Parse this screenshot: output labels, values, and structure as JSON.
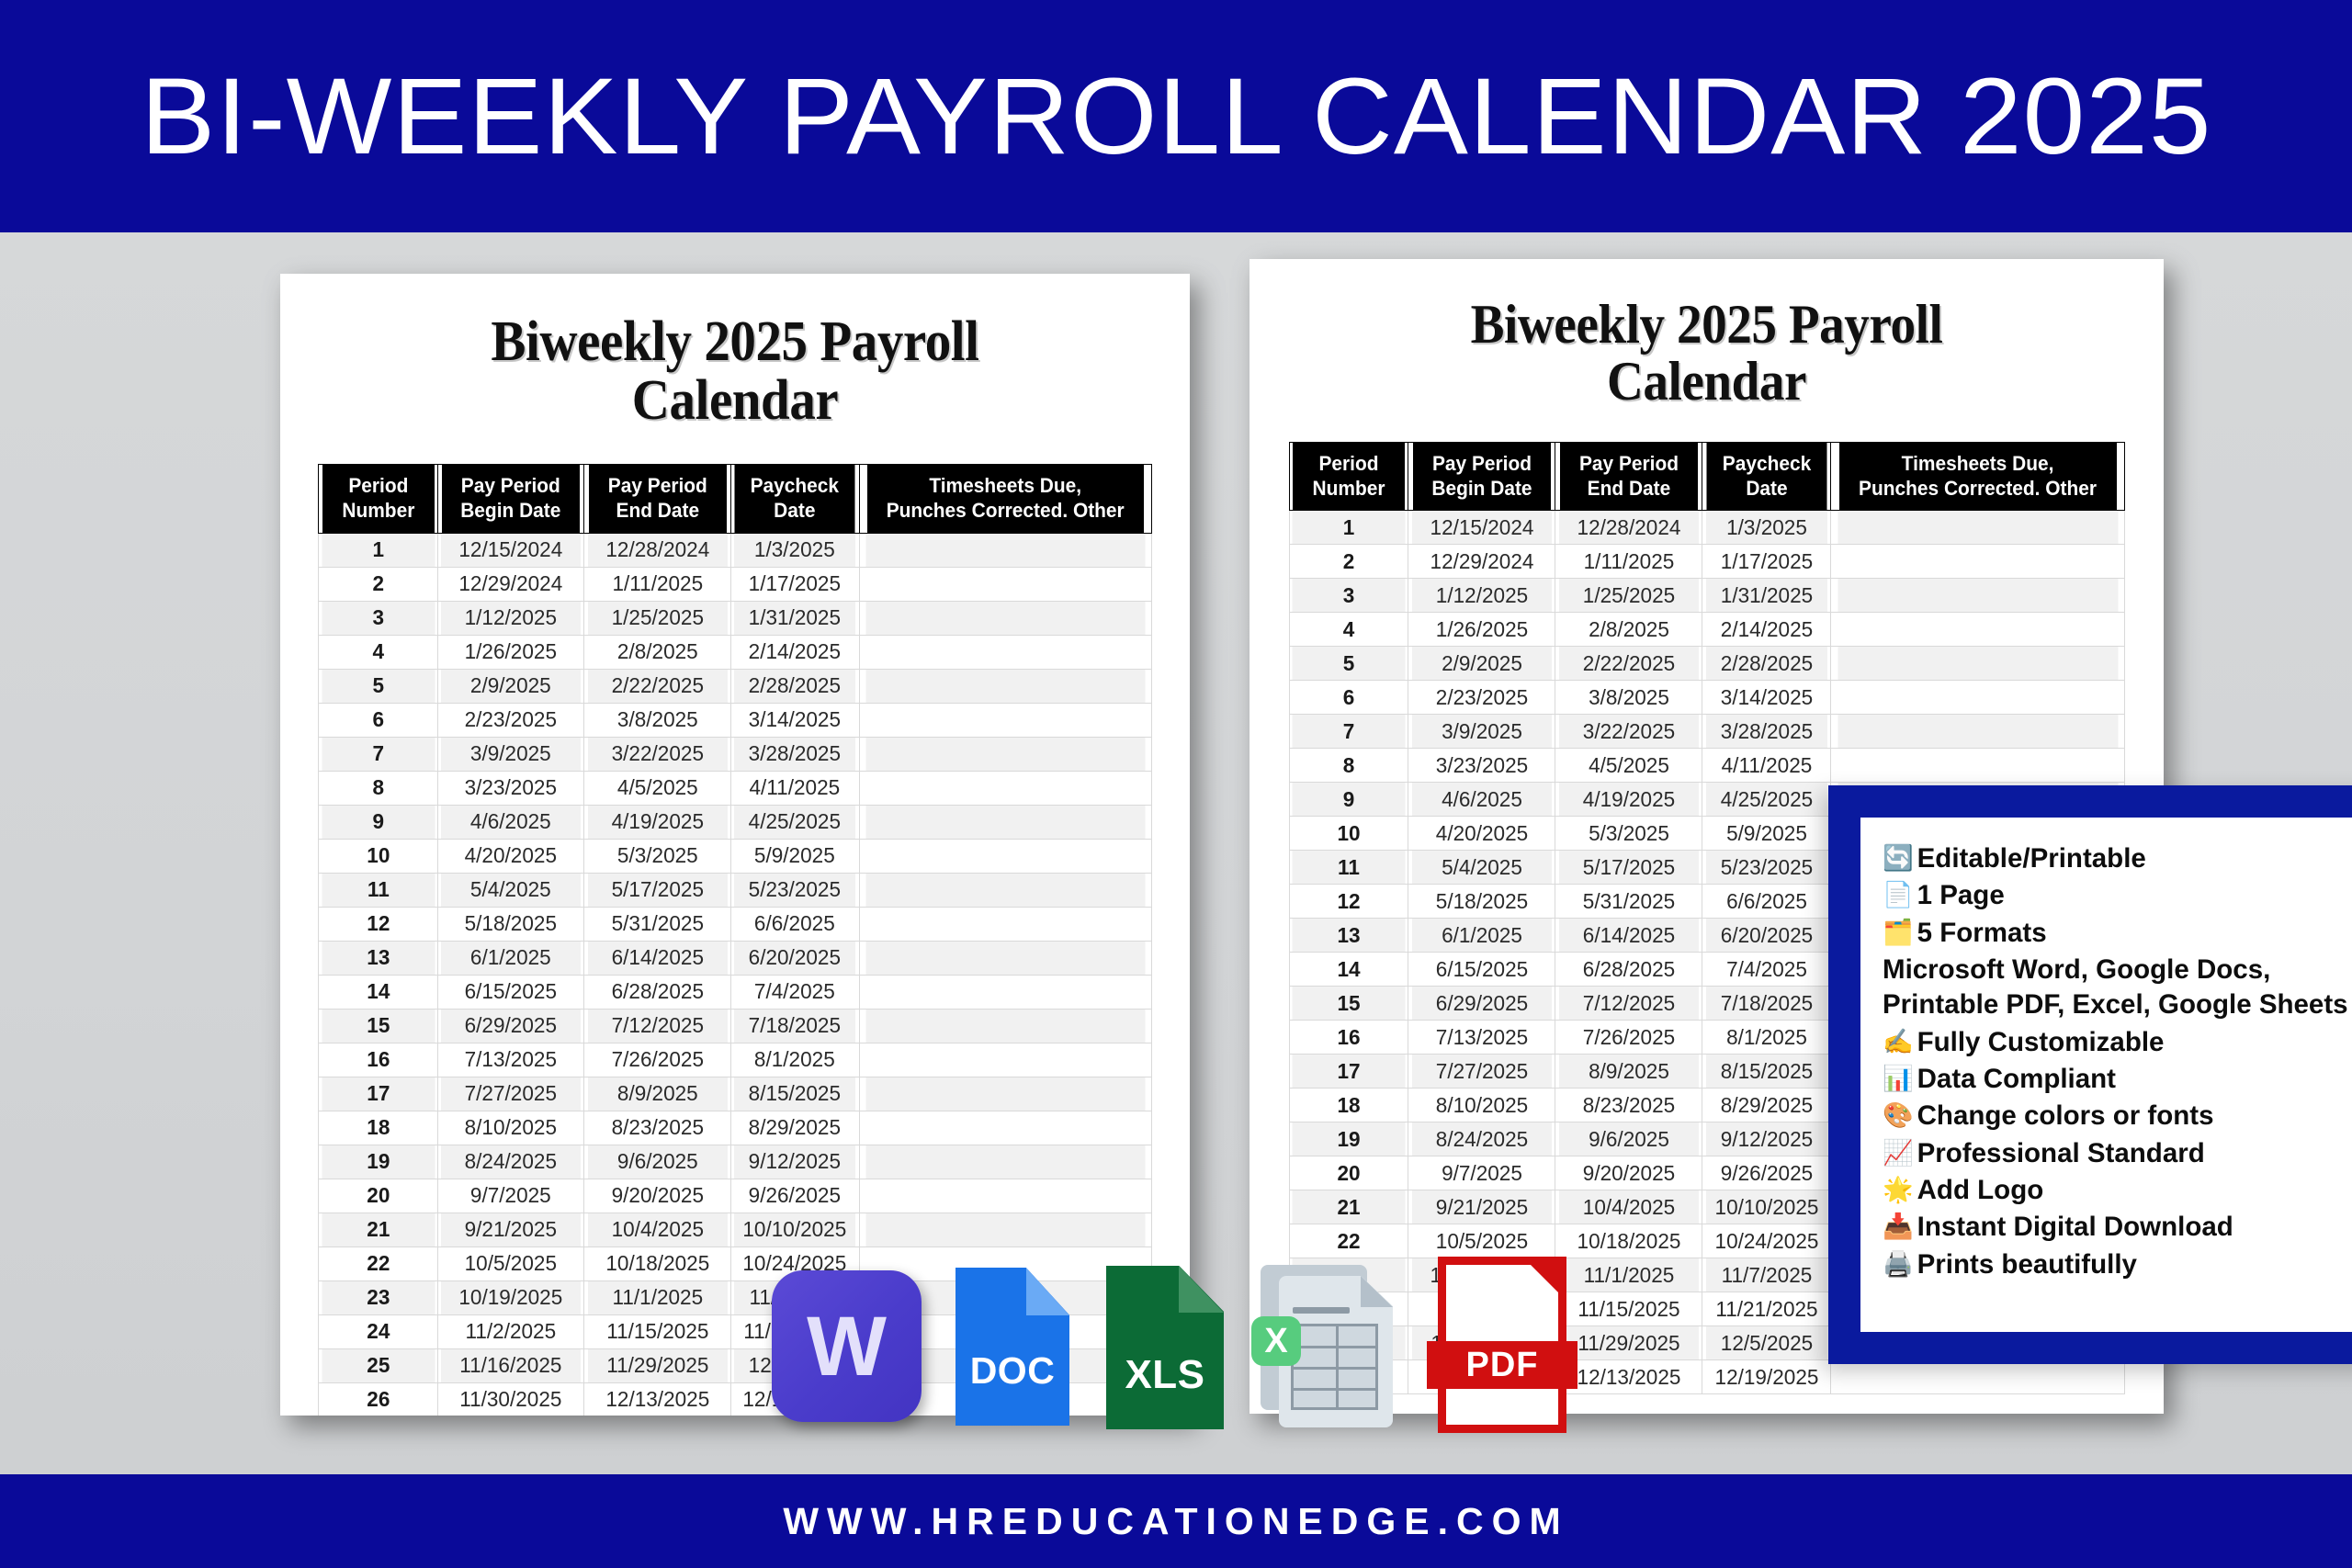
{
  "banner": {
    "title": "BI-WEEKLY PAYROLL CALENDAR 2025"
  },
  "footer": {
    "url": "WWW.HREDUCATIONEDGE.COM"
  },
  "colors": {
    "navy": "#0a0a99",
    "panel_navy": "#0a1a9e",
    "page_background": "#d4d6d8",
    "table_header": "#000000",
    "row_shade": "#f1f1f1"
  },
  "document": {
    "title_line1": "Biweekly 2025 Payroll",
    "title_line2": "Calendar",
    "columns": [
      "Period Number",
      "Pay Period Begin Date",
      "Pay Period End Date",
      "Paycheck Date",
      "Timesheets Due, Punches Corrected. Other"
    ],
    "columns_split": [
      [
        "Period",
        "Number"
      ],
      [
        "Pay Period",
        "Begin Date"
      ],
      [
        "Pay Period",
        "End Date"
      ],
      [
        "Paycheck",
        "Date"
      ],
      [
        "Timesheets Due,",
        "Punches Corrected. Other"
      ]
    ],
    "rows": [
      {
        "period": "1",
        "begin": "12/15/2024",
        "end": "12/28/2024",
        "paycheck": "1/3/2025",
        "notes": ""
      },
      {
        "period": "2",
        "begin": "12/29/2024",
        "end": "1/11/2025",
        "paycheck": "1/17/2025",
        "notes": ""
      },
      {
        "period": "3",
        "begin": "1/12/2025",
        "end": "1/25/2025",
        "paycheck": "1/31/2025",
        "notes": ""
      },
      {
        "period": "4",
        "begin": "1/26/2025",
        "end": "2/8/2025",
        "paycheck": "2/14/2025",
        "notes": ""
      },
      {
        "period": "5",
        "begin": "2/9/2025",
        "end": "2/22/2025",
        "paycheck": "2/28/2025",
        "notes": ""
      },
      {
        "period": "6",
        "begin": "2/23/2025",
        "end": "3/8/2025",
        "paycheck": "3/14/2025",
        "notes": ""
      },
      {
        "period": "7",
        "begin": "3/9/2025",
        "end": "3/22/2025",
        "paycheck": "3/28/2025",
        "notes": ""
      },
      {
        "period": "8",
        "begin": "3/23/2025",
        "end": "4/5/2025",
        "paycheck": "4/11/2025",
        "notes": ""
      },
      {
        "period": "9",
        "begin": "4/6/2025",
        "end": "4/19/2025",
        "paycheck": "4/25/2025",
        "notes": ""
      },
      {
        "period": "10",
        "begin": "4/20/2025",
        "end": "5/3/2025",
        "paycheck": "5/9/2025",
        "notes": ""
      },
      {
        "period": "11",
        "begin": "5/4/2025",
        "end": "5/17/2025",
        "paycheck": "5/23/2025",
        "notes": ""
      },
      {
        "period": "12",
        "begin": "5/18/2025",
        "end": "5/31/2025",
        "paycheck": "6/6/2025",
        "notes": ""
      },
      {
        "period": "13",
        "begin": "6/1/2025",
        "end": "6/14/2025",
        "paycheck": "6/20/2025",
        "notes": ""
      },
      {
        "period": "14",
        "begin": "6/15/2025",
        "end": "6/28/2025",
        "paycheck": "7/4/2025",
        "notes": ""
      },
      {
        "period": "15",
        "begin": "6/29/2025",
        "end": "7/12/2025",
        "paycheck": "7/18/2025",
        "notes": ""
      },
      {
        "period": "16",
        "begin": "7/13/2025",
        "end": "7/26/2025",
        "paycheck": "8/1/2025",
        "notes": ""
      },
      {
        "period": "17",
        "begin": "7/27/2025",
        "end": "8/9/2025",
        "paycheck": "8/15/2025",
        "notes": ""
      },
      {
        "period": "18",
        "begin": "8/10/2025",
        "end": "8/23/2025",
        "paycheck": "8/29/2025",
        "notes": ""
      },
      {
        "period": "19",
        "begin": "8/24/2025",
        "end": "9/6/2025",
        "paycheck": "9/12/2025",
        "notes": ""
      },
      {
        "period": "20",
        "begin": "9/7/2025",
        "end": "9/20/2025",
        "paycheck": "9/26/2025",
        "notes": ""
      },
      {
        "period": "21",
        "begin": "9/21/2025",
        "end": "10/4/2025",
        "paycheck": "10/10/2025",
        "notes": ""
      },
      {
        "period": "22",
        "begin": "10/5/2025",
        "end": "10/18/2025",
        "paycheck": "10/24/2025",
        "notes": ""
      },
      {
        "period": "23",
        "begin": "10/19/2025",
        "end": "11/1/2025",
        "paycheck": "11/7/2025",
        "notes": ""
      },
      {
        "period": "24",
        "begin": "11/2/2025",
        "end": "11/15/2025",
        "paycheck": "11/21/2025",
        "notes": ""
      },
      {
        "period": "25",
        "begin": "11/16/2025",
        "end": "11/29/2025",
        "paycheck": "12/5/2025",
        "notes": ""
      },
      {
        "period": "26",
        "begin": "11/30/2025",
        "end": "12/13/2025",
        "paycheck": "12/19/2025",
        "notes": ""
      }
    ]
  },
  "format_badges": [
    {
      "id": "word",
      "label": "W",
      "icon": "microsoft-word-icon",
      "color": "#4a3ccb"
    },
    {
      "id": "doc",
      "label": "DOC",
      "icon": "google-docs-icon",
      "color": "#1a73e8"
    },
    {
      "id": "xls",
      "label": "XLS",
      "icon": "excel-xls-icon",
      "color": "#0c6b36"
    },
    {
      "id": "sheet",
      "label": "X",
      "icon": "spreadsheet-icon",
      "color": "#57cc7e"
    },
    {
      "id": "pdf",
      "label": "PDF",
      "icon": "pdf-icon",
      "color": "#d10f10"
    }
  ],
  "feature_panel": {
    "items": [
      {
        "icon": "🔄",
        "icon_name": "refresh-icon",
        "text": "Editable/Printable"
      },
      {
        "icon": "📄",
        "icon_name": "page-icon",
        "text": "1 Page"
      },
      {
        "icon": "🗂️",
        "icon_name": "file-box-icon",
        "text": "5 Formats"
      },
      {
        "icon": "",
        "icon_name": "",
        "text": "Microsoft Word, Google Docs, Printable PDF, Excel, Google Sheets"
      },
      {
        "icon": "✍️",
        "icon_name": "writing-hand-icon",
        "text": "Fully Customizable"
      },
      {
        "icon": "📊",
        "icon_name": "bar-chart-icon",
        "text": "Data Compliant"
      },
      {
        "icon": "🎨",
        "icon_name": "palette-icon",
        "text": "Change colors or fonts"
      },
      {
        "icon": "📈",
        "icon_name": "chart-increasing-icon",
        "text": "Professional Standard"
      },
      {
        "icon": "🌟",
        "icon_name": "star-icon",
        "text": "Add Logo"
      },
      {
        "icon": "📥",
        "icon_name": "inbox-tray-icon",
        "text": "Instant Digital Download"
      },
      {
        "icon": "🖨️",
        "icon_name": "printer-icon",
        "text": "Prints beautifully"
      }
    ]
  }
}
